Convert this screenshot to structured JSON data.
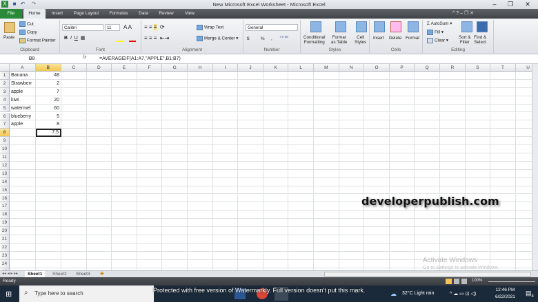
{
  "window": {
    "title": "New Microsoft Excel Worksheet - Microsoft Excel"
  },
  "tabs": [
    "File",
    "Home",
    "Insert",
    "Page Layout",
    "Formulas",
    "Data",
    "Review",
    "View"
  ],
  "ribbon": {
    "clipboard": {
      "label": "Clipboard",
      "paste": "Paste",
      "cut": "Cut",
      "copy": "Copy",
      "format_painter": "Format Painter"
    },
    "font": {
      "label": "Font",
      "name": "Calibri",
      "size": "11"
    },
    "alignment": {
      "label": "Alignment",
      "wrap": "Wrap Text",
      "merge": "Merge & Center"
    },
    "number": {
      "label": "Number",
      "format": "General",
      "currency": "$",
      "percent": "%",
      "comma": ","
    },
    "styles": {
      "label": "Styles",
      "conditional": "Conditional",
      "conditional2": "Formatting",
      "table": "Format",
      "table2": "as Table",
      "cell": "Cell",
      "cell2": "Styles"
    },
    "cells": {
      "label": "Cells",
      "insert": "Insert",
      "delete": "Delete",
      "format": "Format"
    },
    "editing": {
      "label": "Editing",
      "autosum": "AutoSum",
      "fill": "Fill",
      "clear": "Clear",
      "sort": "Sort &",
      "sort2": "Filter",
      "find": "Find &",
      "find2": "Select"
    }
  },
  "formula_bar": {
    "name_box": "B8",
    "fx": "fx",
    "formula": "=AVERAGEIF(A1:A7,\"APPLE\",B1:B7)"
  },
  "columns": [
    "A",
    "B",
    "C",
    "D",
    "E",
    "F",
    "G",
    "H",
    "I",
    "J",
    "K",
    "L",
    "M",
    "N",
    "O",
    "P",
    "Q",
    "R",
    "S",
    "T",
    "U"
  ],
  "rows": [
    {
      "a": "Banana",
      "b": "48"
    },
    {
      "a": "Strawberr",
      "b": "2"
    },
    {
      "a": "apple",
      "b": "7"
    },
    {
      "a": "kiwi",
      "b": "20"
    },
    {
      "a": "watermel",
      "b": "60"
    },
    {
      "a": "blueberry",
      "b": "5"
    },
    {
      "a": "apple",
      "b": "8"
    },
    {
      "a": "",
      "b": "7.5"
    }
  ],
  "row_count": 25,
  "sheets": [
    "Sheet1",
    "Sheet2",
    "Sheet3"
  ],
  "status": {
    "ready": "Ready",
    "zoom": "100%"
  },
  "overlay": {
    "site": "developerpublish.com",
    "activate": "Activate Windows",
    "activate_sub": "Go to Settings to activate Windows.",
    "watermark": "Protected with free version of Watermarkly. Full version doesn't put this mark."
  },
  "taskbar": {
    "search": "Type here to search",
    "weather": "32°C  Light rain",
    "time": "12:46 PM",
    "date": "6/22/2021",
    "notifications": "4"
  }
}
